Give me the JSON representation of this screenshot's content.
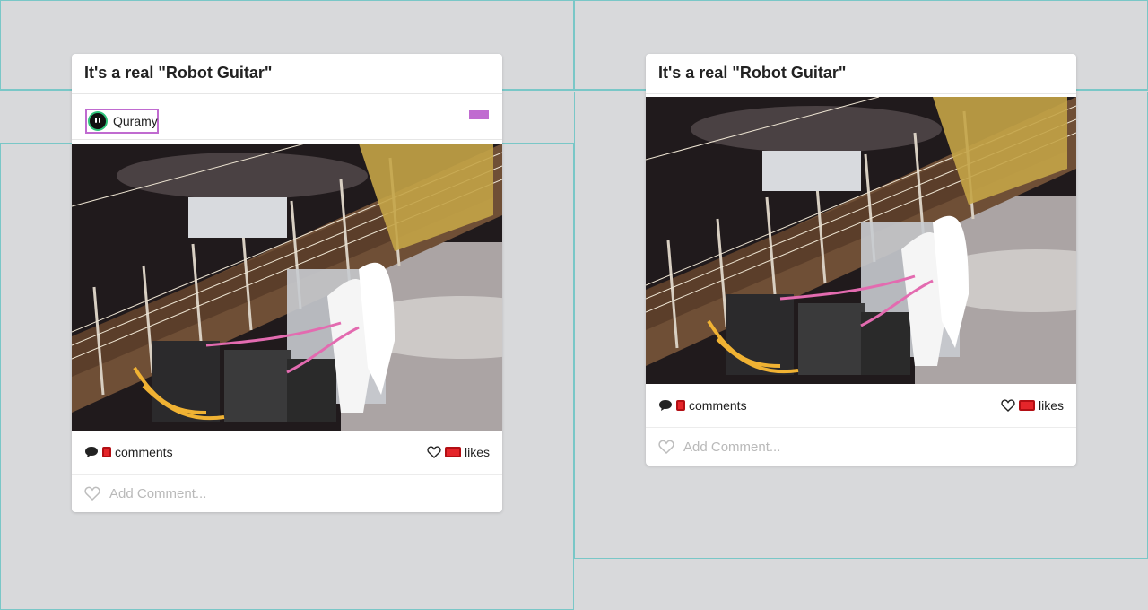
{
  "cards": [
    {
      "title": "It's a real \"Robot Guitar\"",
      "author": {
        "name": "Quramy"
      },
      "comments_label": "comments",
      "likes_label": "likes",
      "add_comment_placeholder": "Add Comment..."
    },
    {
      "title": "It's a real \"Robot Guitar\"",
      "comments_label": "comments",
      "likes_label": "likes",
      "add_comment_placeholder": "Add Comment..."
    }
  ],
  "icons": {
    "comment": "comment-icon",
    "heart": "heart-icon",
    "like": "heart-icon"
  },
  "colors": {
    "background": "#d8d9db",
    "card": "#ffffff",
    "accent_red": "#e5252a",
    "accent_purple": "#c06bd0",
    "avatar_green": "#2fc47a",
    "muted_text": "#b9b9b9"
  }
}
